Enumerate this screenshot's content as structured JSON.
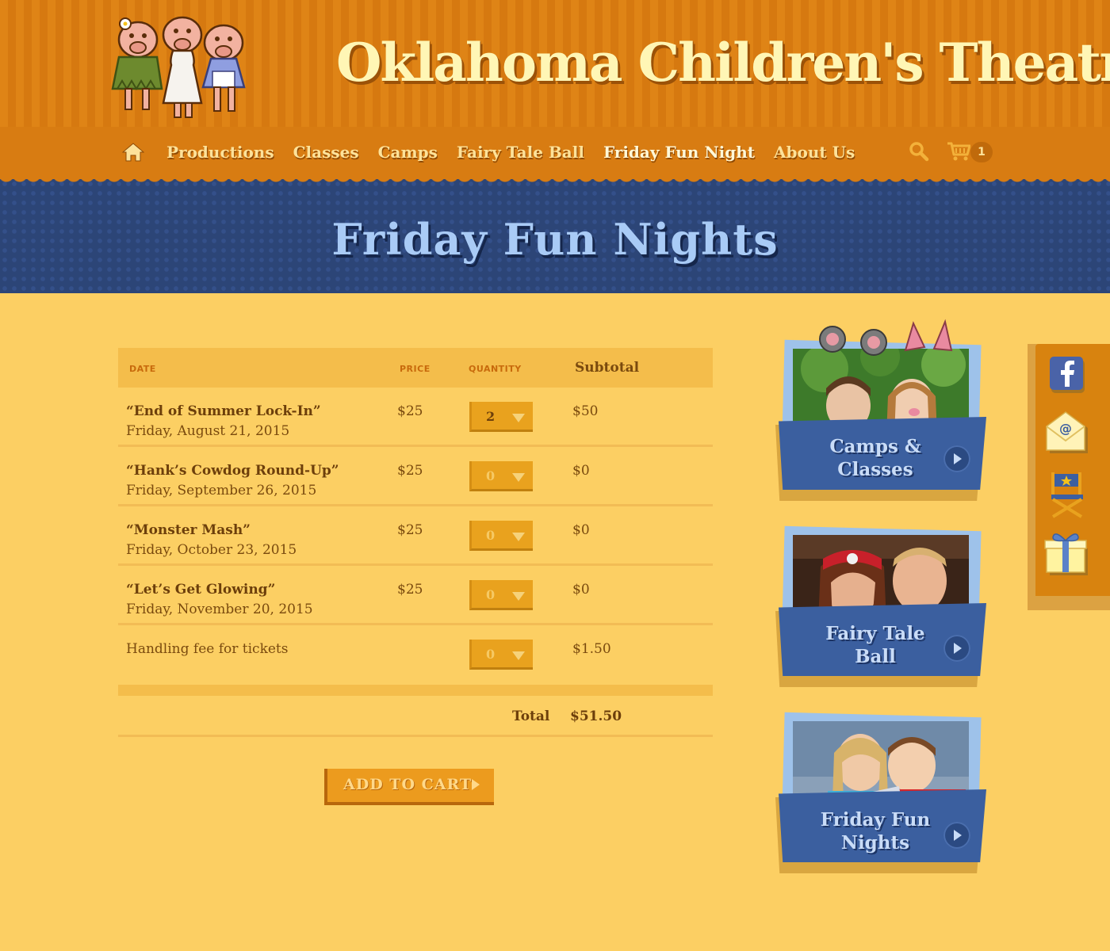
{
  "site": {
    "title": "Oklahoma Children's Theatre"
  },
  "nav": {
    "items": [
      {
        "label": "Productions"
      },
      {
        "label": "Classes"
      },
      {
        "label": "Camps"
      },
      {
        "label": "Fairy Tale Ball"
      },
      {
        "label": "Friday Fun Night",
        "active": true
      },
      {
        "label": "About Us"
      }
    ],
    "cart_count": "1"
  },
  "page": {
    "title": "Friday Fun Nights"
  },
  "table": {
    "headers": {
      "date": "DATE",
      "price": "PRICE",
      "quantity": "QUANTITY",
      "subtotal": "Subtotal"
    },
    "rows": [
      {
        "title": "“End of Summer Lock-In”",
        "date": "Friday, August 21, 2015",
        "price": "$25",
        "quantity": "2",
        "subtotal": "$50"
      },
      {
        "title": "“Hank’s Cowdog Round-Up”",
        "date": "Friday, September 26, 2015",
        "price": "$25",
        "quantity": "0",
        "subtotal": "$0"
      },
      {
        "title": "“Monster Mash”",
        "date": "Friday, October 23, 2015",
        "price": "$25",
        "quantity": "0",
        "subtotal": "$0"
      },
      {
        "title": "“Let’s Get Glowing”",
        "date": "Friday, November 20, 2015",
        "price": "$25",
        "quantity": "0",
        "subtotal": "$0"
      }
    ],
    "fee": {
      "label": "Handling fee for tickets",
      "quantity": "0",
      "subtotal": "$1.50"
    },
    "total_label": "Total",
    "total_value": "$51.50"
  },
  "add_to_cart": {
    "label": "ADD TO CART"
  },
  "promos": [
    {
      "title_line1": "Camps &",
      "title_line2": "Classes"
    },
    {
      "title_line1": "Fairy Tale",
      "title_line2": "Ball"
    },
    {
      "title_line1": "Friday Fun",
      "title_line2": "Nights"
    }
  ],
  "social": [
    {
      "icon": "facebook-icon"
    },
    {
      "icon": "email-icon"
    },
    {
      "icon": "directors-chair-icon"
    },
    {
      "icon": "gift-icon"
    }
  ],
  "colors": {
    "header_orange": "#df8416",
    "nav_orange": "#d87c12",
    "banner_blue": "#2c4577",
    "page_bg": "#fccf63",
    "promo_blue": "#3b5f9f"
  }
}
